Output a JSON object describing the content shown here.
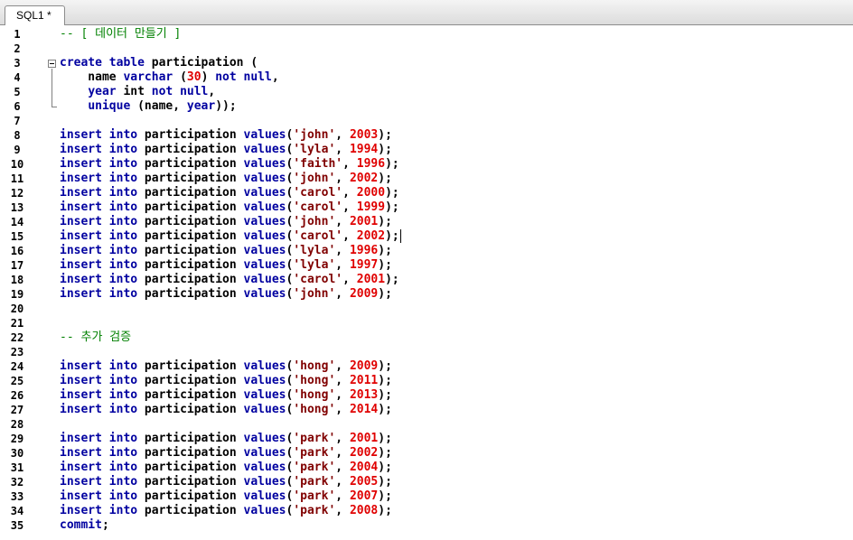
{
  "tab": {
    "label": "SQL1 *"
  },
  "colors": {
    "keyword": "#0000a0",
    "string": "#800000",
    "number": "#e00000",
    "comment": "#008000"
  },
  "lines": [
    [
      [
        "c",
        "-- [ 데이터 만들기 ]"
      ]
    ],
    [],
    [
      [
        "k",
        "create"
      ],
      [
        "t",
        " "
      ],
      [
        "k",
        "table"
      ],
      [
        "t",
        " participation ("
      ]
    ],
    [
      [
        "t",
        "    name "
      ],
      [
        "k",
        "varchar"
      ],
      [
        "t",
        " ("
      ],
      [
        "n",
        "30"
      ],
      [
        "t",
        ") "
      ],
      [
        "k",
        "not"
      ],
      [
        "t",
        " "
      ],
      [
        "k",
        "null"
      ],
      [
        "t",
        ","
      ]
    ],
    [
      [
        "t",
        "    "
      ],
      [
        "k",
        "year"
      ],
      [
        "t",
        " int "
      ],
      [
        "k",
        "not"
      ],
      [
        "t",
        " "
      ],
      [
        "k",
        "null"
      ],
      [
        "t",
        ","
      ]
    ],
    [
      [
        "t",
        "    "
      ],
      [
        "k",
        "unique"
      ],
      [
        "t",
        " (name, "
      ],
      [
        "k",
        "year"
      ],
      [
        "t",
        "));"
      ]
    ],
    [],
    [
      [
        "k",
        "insert"
      ],
      [
        "t",
        " "
      ],
      [
        "k",
        "into"
      ],
      [
        "t",
        " participation "
      ],
      [
        "k",
        "values"
      ],
      [
        "t",
        "("
      ],
      [
        "s",
        "'john'"
      ],
      [
        "t",
        ", "
      ],
      [
        "n",
        "2003"
      ],
      [
        "t",
        ");"
      ]
    ],
    [
      [
        "k",
        "insert"
      ],
      [
        "t",
        " "
      ],
      [
        "k",
        "into"
      ],
      [
        "t",
        " participation "
      ],
      [
        "k",
        "values"
      ],
      [
        "t",
        "("
      ],
      [
        "s",
        "'lyla'"
      ],
      [
        "t",
        ", "
      ],
      [
        "n",
        "1994"
      ],
      [
        "t",
        ");"
      ]
    ],
    [
      [
        "k",
        "insert"
      ],
      [
        "t",
        " "
      ],
      [
        "k",
        "into"
      ],
      [
        "t",
        " participation "
      ],
      [
        "k",
        "values"
      ],
      [
        "t",
        "("
      ],
      [
        "s",
        "'faith'"
      ],
      [
        "t",
        ", "
      ],
      [
        "n",
        "1996"
      ],
      [
        "t",
        ");"
      ]
    ],
    [
      [
        "k",
        "insert"
      ],
      [
        "t",
        " "
      ],
      [
        "k",
        "into"
      ],
      [
        "t",
        " participation "
      ],
      [
        "k",
        "values"
      ],
      [
        "t",
        "("
      ],
      [
        "s",
        "'john'"
      ],
      [
        "t",
        ", "
      ],
      [
        "n",
        "2002"
      ],
      [
        "t",
        ");"
      ]
    ],
    [
      [
        "k",
        "insert"
      ],
      [
        "t",
        " "
      ],
      [
        "k",
        "into"
      ],
      [
        "t",
        " participation "
      ],
      [
        "k",
        "values"
      ],
      [
        "t",
        "("
      ],
      [
        "s",
        "'carol'"
      ],
      [
        "t",
        ", "
      ],
      [
        "n",
        "2000"
      ],
      [
        "t",
        ");"
      ]
    ],
    [
      [
        "k",
        "insert"
      ],
      [
        "t",
        " "
      ],
      [
        "k",
        "into"
      ],
      [
        "t",
        " participation "
      ],
      [
        "k",
        "values"
      ],
      [
        "t",
        "("
      ],
      [
        "s",
        "'carol'"
      ],
      [
        "t",
        ", "
      ],
      [
        "n",
        "1999"
      ],
      [
        "t",
        ");"
      ]
    ],
    [
      [
        "k",
        "insert"
      ],
      [
        "t",
        " "
      ],
      [
        "k",
        "into"
      ],
      [
        "t",
        " participation "
      ],
      [
        "k",
        "values"
      ],
      [
        "t",
        "("
      ],
      [
        "s",
        "'john'"
      ],
      [
        "t",
        ", "
      ],
      [
        "n",
        "2001"
      ],
      [
        "t",
        ");"
      ]
    ],
    [
      [
        "k",
        "insert"
      ],
      [
        "t",
        " "
      ],
      [
        "k",
        "into"
      ],
      [
        "t",
        " participation "
      ],
      [
        "k",
        "values"
      ],
      [
        "t",
        "("
      ],
      [
        "s",
        "'carol'"
      ],
      [
        "t",
        ", "
      ],
      [
        "n",
        "2002"
      ],
      [
        "t",
        ");"
      ]
    ],
    [
      [
        "k",
        "insert"
      ],
      [
        "t",
        " "
      ],
      [
        "k",
        "into"
      ],
      [
        "t",
        " participation "
      ],
      [
        "k",
        "values"
      ],
      [
        "t",
        "("
      ],
      [
        "s",
        "'lyla'"
      ],
      [
        "t",
        ", "
      ],
      [
        "n",
        "1996"
      ],
      [
        "t",
        ");"
      ]
    ],
    [
      [
        "k",
        "insert"
      ],
      [
        "t",
        " "
      ],
      [
        "k",
        "into"
      ],
      [
        "t",
        " participation "
      ],
      [
        "k",
        "values"
      ],
      [
        "t",
        "("
      ],
      [
        "s",
        "'lyla'"
      ],
      [
        "t",
        ", "
      ],
      [
        "n",
        "1997"
      ],
      [
        "t",
        ");"
      ]
    ],
    [
      [
        "k",
        "insert"
      ],
      [
        "t",
        " "
      ],
      [
        "k",
        "into"
      ],
      [
        "t",
        " participation "
      ],
      [
        "k",
        "values"
      ],
      [
        "t",
        "("
      ],
      [
        "s",
        "'carol'"
      ],
      [
        "t",
        ", "
      ],
      [
        "n",
        "2001"
      ],
      [
        "t",
        ");"
      ]
    ],
    [
      [
        "k",
        "insert"
      ],
      [
        "t",
        " "
      ],
      [
        "k",
        "into"
      ],
      [
        "t",
        " participation "
      ],
      [
        "k",
        "values"
      ],
      [
        "t",
        "("
      ],
      [
        "s",
        "'john'"
      ],
      [
        "t",
        ", "
      ],
      [
        "n",
        "2009"
      ],
      [
        "t",
        ");"
      ]
    ],
    [],
    [],
    [
      [
        "c",
        "-- 추가 검증"
      ]
    ],
    [],
    [
      [
        "k",
        "insert"
      ],
      [
        "t",
        " "
      ],
      [
        "k",
        "into"
      ],
      [
        "t",
        " participation "
      ],
      [
        "k",
        "values"
      ],
      [
        "t",
        "("
      ],
      [
        "s",
        "'hong'"
      ],
      [
        "t",
        ", "
      ],
      [
        "n",
        "2009"
      ],
      [
        "t",
        ");"
      ]
    ],
    [
      [
        "k",
        "insert"
      ],
      [
        "t",
        " "
      ],
      [
        "k",
        "into"
      ],
      [
        "t",
        " participation "
      ],
      [
        "k",
        "values"
      ],
      [
        "t",
        "("
      ],
      [
        "s",
        "'hong'"
      ],
      [
        "t",
        ", "
      ],
      [
        "n",
        "2011"
      ],
      [
        "t",
        ");"
      ]
    ],
    [
      [
        "k",
        "insert"
      ],
      [
        "t",
        " "
      ],
      [
        "k",
        "into"
      ],
      [
        "t",
        " participation "
      ],
      [
        "k",
        "values"
      ],
      [
        "t",
        "("
      ],
      [
        "s",
        "'hong'"
      ],
      [
        "t",
        ", "
      ],
      [
        "n",
        "2013"
      ],
      [
        "t",
        ");"
      ]
    ],
    [
      [
        "k",
        "insert"
      ],
      [
        "t",
        " "
      ],
      [
        "k",
        "into"
      ],
      [
        "t",
        " participation "
      ],
      [
        "k",
        "values"
      ],
      [
        "t",
        "("
      ],
      [
        "s",
        "'hong'"
      ],
      [
        "t",
        ", "
      ],
      [
        "n",
        "2014"
      ],
      [
        "t",
        ");"
      ]
    ],
    [],
    [
      [
        "k",
        "insert"
      ],
      [
        "t",
        " "
      ],
      [
        "k",
        "into"
      ],
      [
        "t",
        " participation "
      ],
      [
        "k",
        "values"
      ],
      [
        "t",
        "("
      ],
      [
        "s",
        "'park'"
      ],
      [
        "t",
        ", "
      ],
      [
        "n",
        "2001"
      ],
      [
        "t",
        ");"
      ]
    ],
    [
      [
        "k",
        "insert"
      ],
      [
        "t",
        " "
      ],
      [
        "k",
        "into"
      ],
      [
        "t",
        " participation "
      ],
      [
        "k",
        "values"
      ],
      [
        "t",
        "("
      ],
      [
        "s",
        "'park'"
      ],
      [
        "t",
        ", "
      ],
      [
        "n",
        "2002"
      ],
      [
        "t",
        ");"
      ]
    ],
    [
      [
        "k",
        "insert"
      ],
      [
        "t",
        " "
      ],
      [
        "k",
        "into"
      ],
      [
        "t",
        " participation "
      ],
      [
        "k",
        "values"
      ],
      [
        "t",
        "("
      ],
      [
        "s",
        "'park'"
      ],
      [
        "t",
        ", "
      ],
      [
        "n",
        "2004"
      ],
      [
        "t",
        ");"
      ]
    ],
    [
      [
        "k",
        "insert"
      ],
      [
        "t",
        " "
      ],
      [
        "k",
        "into"
      ],
      [
        "t",
        " participation "
      ],
      [
        "k",
        "values"
      ],
      [
        "t",
        "("
      ],
      [
        "s",
        "'park'"
      ],
      [
        "t",
        ", "
      ],
      [
        "n",
        "2005"
      ],
      [
        "t",
        ");"
      ]
    ],
    [
      [
        "k",
        "insert"
      ],
      [
        "t",
        " "
      ],
      [
        "k",
        "into"
      ],
      [
        "t",
        " participation "
      ],
      [
        "k",
        "values"
      ],
      [
        "t",
        "("
      ],
      [
        "s",
        "'park'"
      ],
      [
        "t",
        ", "
      ],
      [
        "n",
        "2007"
      ],
      [
        "t",
        ");"
      ]
    ],
    [
      [
        "k",
        "insert"
      ],
      [
        "t",
        " "
      ],
      [
        "k",
        "into"
      ],
      [
        "t",
        " participation "
      ],
      [
        "k",
        "values"
      ],
      [
        "t",
        "("
      ],
      [
        "s",
        "'park'"
      ],
      [
        "t",
        ", "
      ],
      [
        "n",
        "2008"
      ],
      [
        "t",
        ");"
      ]
    ],
    [
      [
        "k",
        "commit"
      ],
      [
        "t",
        ";"
      ]
    ]
  ],
  "line_numbers": [
    "1",
    "2",
    "3",
    "4",
    "5",
    "6",
    "7",
    "8",
    "9",
    "10",
    "11",
    "12",
    "13",
    "14",
    "15",
    "16",
    "17",
    "18",
    "19",
    "20",
    "21",
    "22",
    "23",
    "24",
    "25",
    "26",
    "27",
    "28",
    "29",
    "30",
    "31",
    "32",
    "33",
    "34",
    "35"
  ],
  "fold_icon": "collapse-minus-icon"
}
